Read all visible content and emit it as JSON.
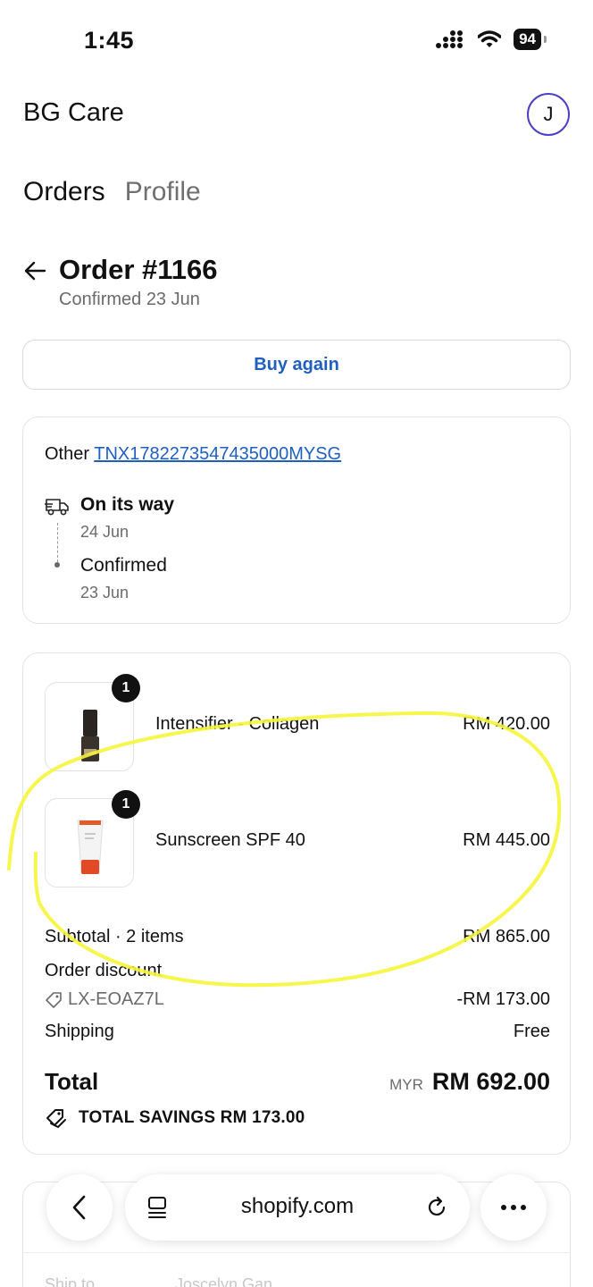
{
  "status_bar": {
    "time": "1:45",
    "battery": "94"
  },
  "header": {
    "app_title": "BG Care",
    "avatar_initial": "J"
  },
  "nav": {
    "tabs": [
      {
        "label": "Orders",
        "active": true
      },
      {
        "label": "Profile",
        "active": false
      }
    ]
  },
  "order": {
    "title": "Order #1166",
    "subtitle": "Confirmed 23 Jun",
    "buy_again_label": "Buy again"
  },
  "tracking": {
    "carrier_label": "Other",
    "tracking_number": "TNX1782273547435000MYSG",
    "events": [
      {
        "title": "On its way",
        "date": "24 Jun"
      },
      {
        "title": "Confirmed",
        "date": "23 Jun"
      }
    ]
  },
  "items": [
    {
      "quantity": "1",
      "name": "Intensifier - Collagen",
      "price": "RM 420.00"
    },
    {
      "quantity": "1",
      "name": "Sunscreen SPF 40",
      "price": "RM 445.00"
    }
  ],
  "summary": {
    "subtotal_label": "Subtotal · 2 items",
    "subtotal_value": "RM 865.00",
    "discount_label": "Order discount",
    "discount_code": "LX-EOAZ7L",
    "discount_value": "-RM 173.00",
    "shipping_label": "Shipping",
    "shipping_value": "Free",
    "total_label": "Total",
    "total_currency": "MYR",
    "total_value": "RM 692.00",
    "savings_label": "TOTAL SAVINGS RM 173.00"
  },
  "shipping_card": {
    "faded_label": "Ship to",
    "faded_value": "Joscelyn Gan"
  },
  "browser": {
    "url": "shopify.com"
  },
  "colors": {
    "link": "#1f5fbf",
    "avatar_ring": "#4b3fc4",
    "highlight": "#f5f53a"
  }
}
